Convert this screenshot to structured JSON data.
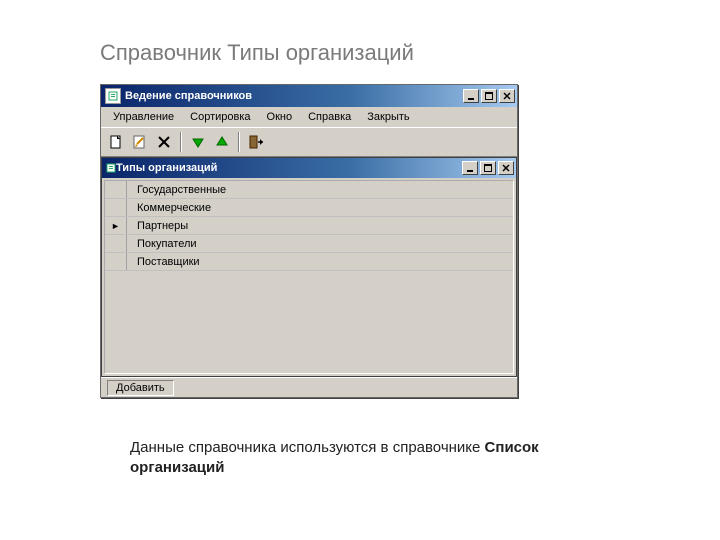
{
  "slide": {
    "title": "Справочник Типы организаций",
    "caption_prefix": "Данные справочника используются в справочнике ",
    "caption_bold": "Список организаций"
  },
  "mainWindow": {
    "title": "Ведение справочников",
    "menu": [
      "Управление",
      "Сортировка",
      "Окно",
      "Справка",
      "Закрыть"
    ],
    "toolbar_icons": [
      "new",
      "edit",
      "delete",
      "sep",
      "sort-asc",
      "sort-desc",
      "sep",
      "exit"
    ],
    "statusbar": "Добавить"
  },
  "childWindow": {
    "title": "Типы организаций",
    "rows": [
      {
        "indicator": "",
        "text": "Государственные"
      },
      {
        "indicator": "",
        "text": "Коммерческие"
      },
      {
        "indicator": "►",
        "text": "Партнеры"
      },
      {
        "indicator": "",
        "text": "Покупатели"
      },
      {
        "indicator": "",
        "text": "Поставщики"
      }
    ]
  }
}
